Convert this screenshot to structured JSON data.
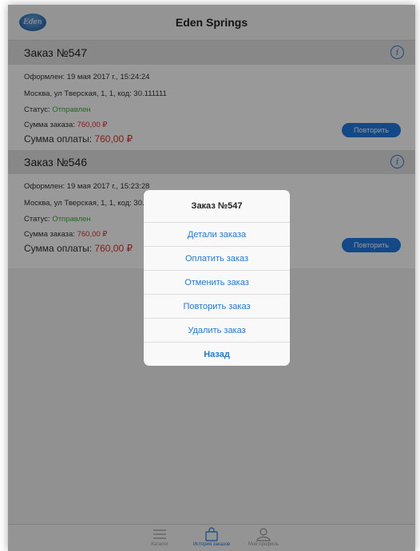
{
  "app": {
    "title": "Eden Springs",
    "logo_text": "Eden"
  },
  "orders": [
    {
      "title": "Заказ №547",
      "date": "Оформлен: 19 мая 2017 г., 15:24:24",
      "address": "Москва, ул Тверская, 1, 1, код: 30.111111",
      "status_label": "Статус: ",
      "status_value": "Отправлен",
      "order_sum_label": "Сумма заказа: ",
      "order_sum_value": "760,00 ₽",
      "pay_sum_label": "Сумма оплаты: ",
      "pay_sum_value": "760,00 ₽",
      "repeat_label": "Повторить"
    },
    {
      "title": "Заказ №546",
      "date": "Оформлен: 19 мая 2017 г., 15:23:28",
      "address": "Москва, ул Тверская, 1, 1, код: 30.111111",
      "status_label": "Статус: ",
      "status_value": "Отправлен",
      "order_sum_label": "Сумма заказа: ",
      "order_sum_value": "760,00 ₽",
      "pay_sum_label": "Сумма оплаты: ",
      "pay_sum_value": "760,00 ₽",
      "repeat_label": "Повторить"
    }
  ],
  "action_sheet": {
    "title": "Заказ №547",
    "items": [
      "Детали заказа",
      "Оплатить заказ",
      "Отменить заказ",
      "Повторить заказ",
      "Удалить заказ"
    ],
    "cancel": "Назад"
  },
  "tabbar": {
    "items": [
      {
        "label": "Каталог",
        "icon": "list-icon"
      },
      {
        "label": "История заказов",
        "icon": "bag-icon"
      },
      {
        "label": "Мой профиль",
        "icon": "person-icon"
      }
    ],
    "active_index": 1
  },
  "colors": {
    "accent": "#1f7ae0",
    "status_green": "#3fae3f",
    "price_red": "#d8322b"
  }
}
